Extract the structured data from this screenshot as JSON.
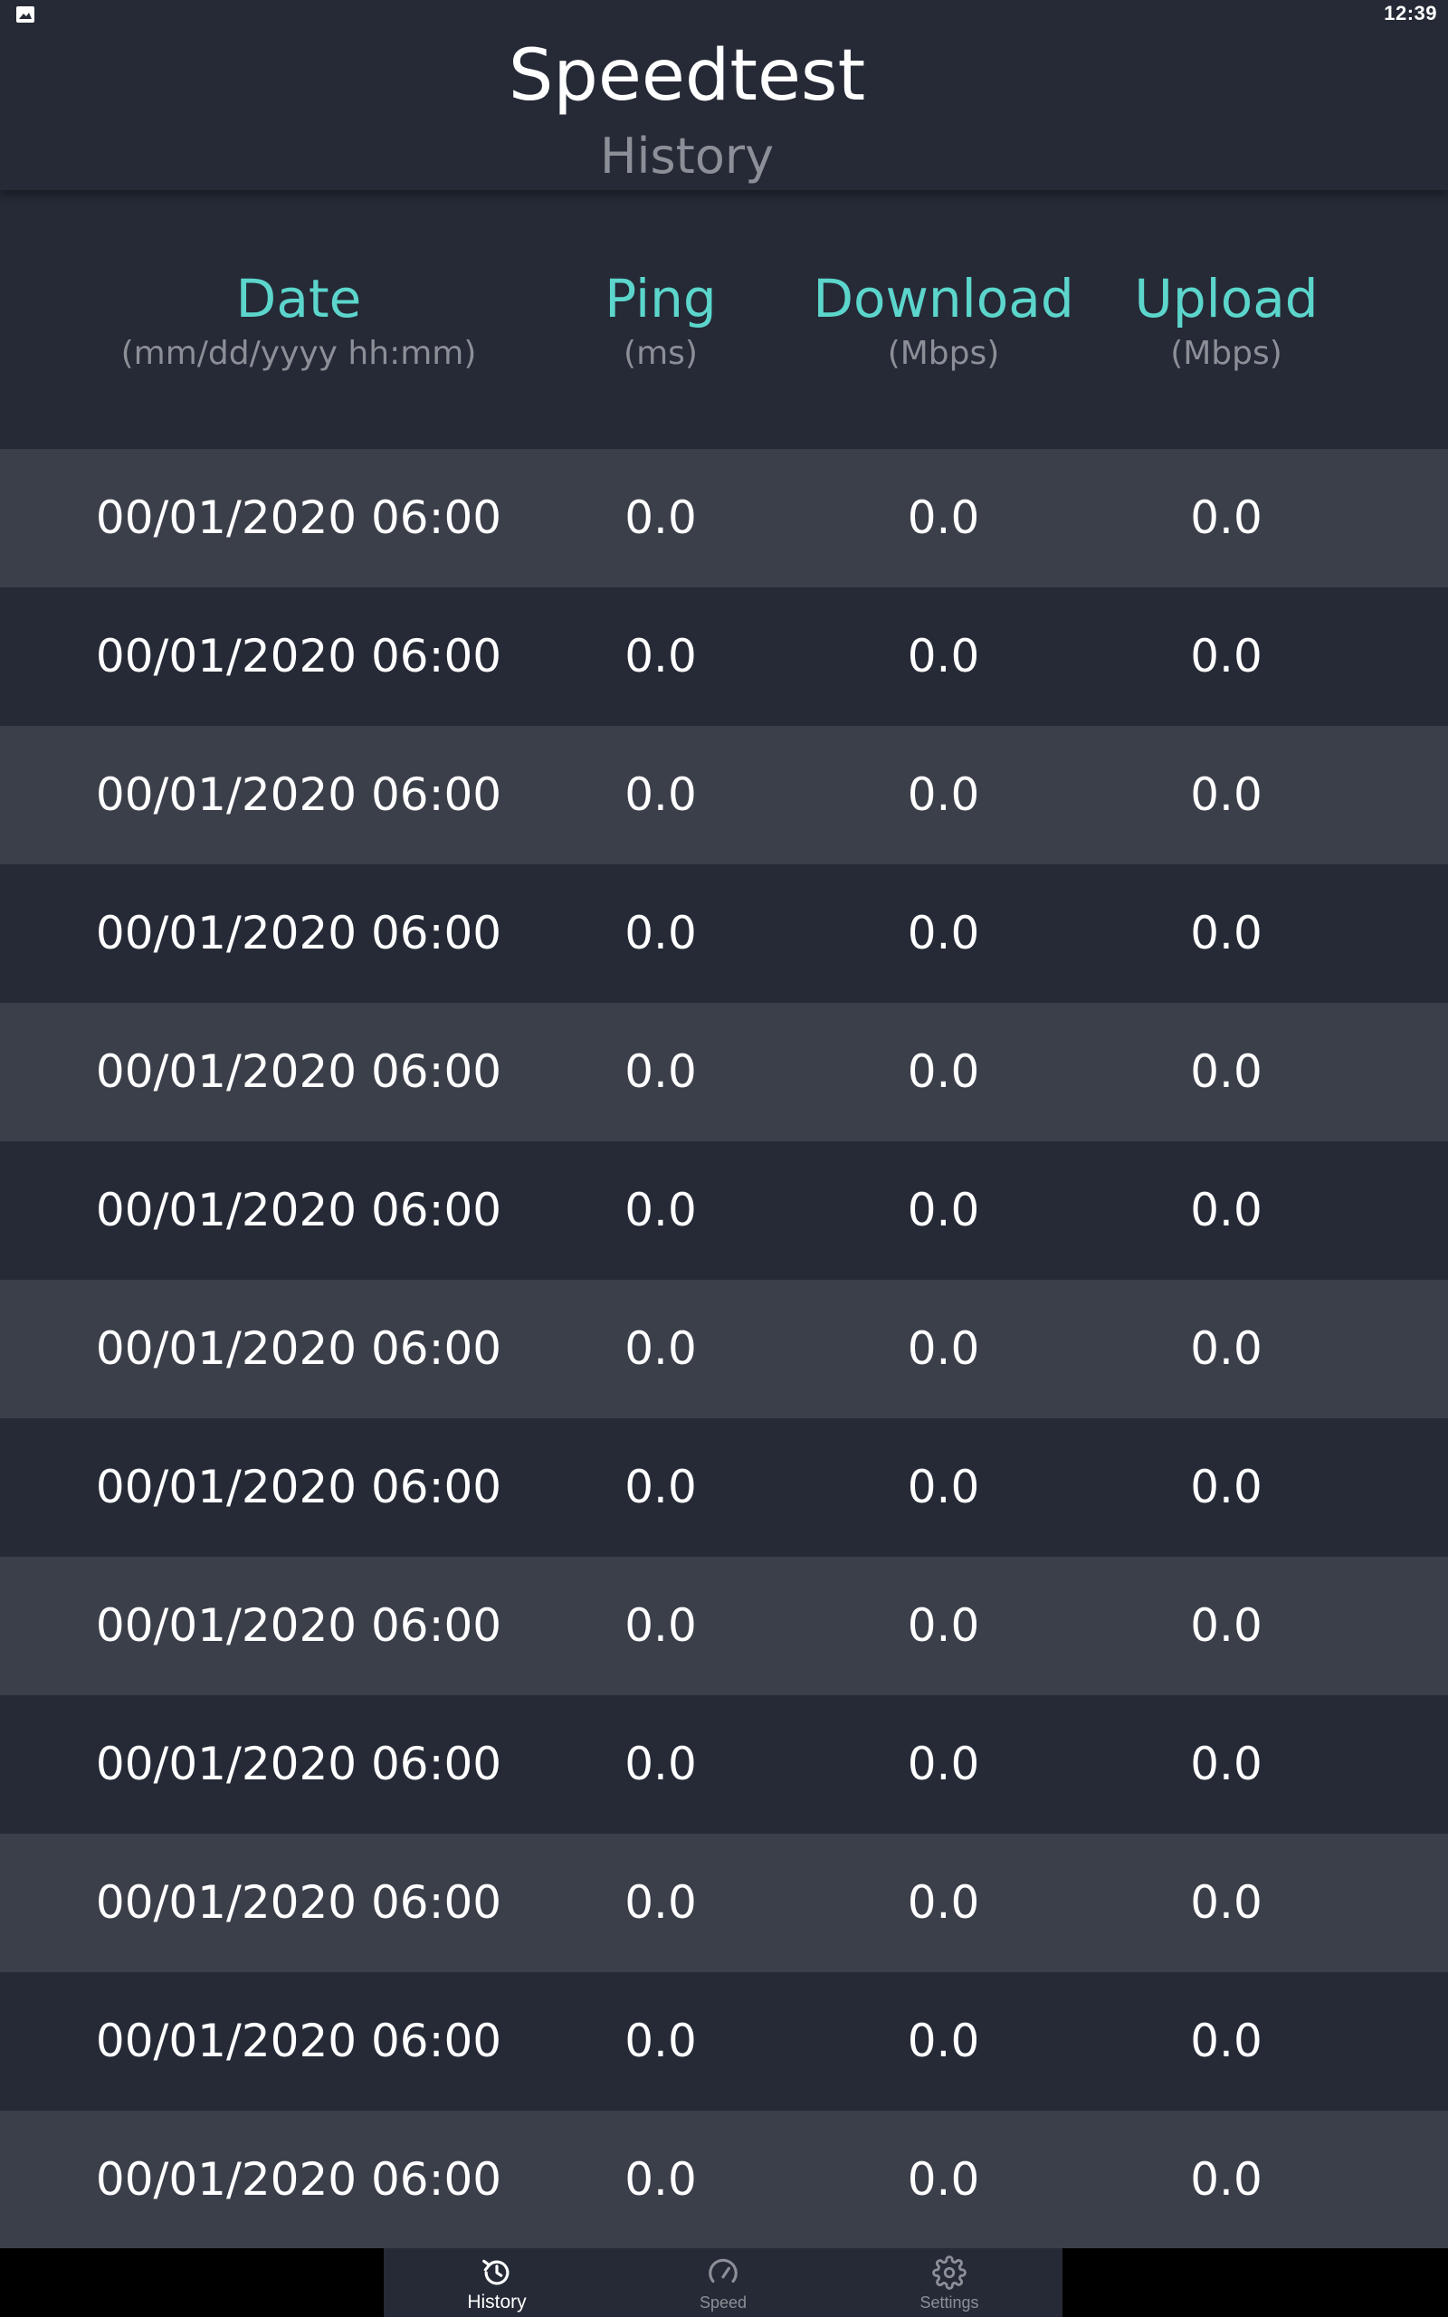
{
  "status_bar": {
    "time": "12:39",
    "notification_icon": "image-icon"
  },
  "header": {
    "title": "Speedtest",
    "subtitle": "History"
  },
  "columns": [
    {
      "name": "Date",
      "unit": "(mm/dd/yyyy hh:mm)"
    },
    {
      "name": "Ping",
      "unit": "(ms)"
    },
    {
      "name": "Download",
      "unit": "(Mbps)"
    },
    {
      "name": "Upload",
      "unit": "(Mbps)"
    }
  ],
  "rows": [
    {
      "date": "00/01/2020 06:00",
      "ping": "0.0",
      "download": "0.0",
      "upload": "0.0"
    },
    {
      "date": "00/01/2020 06:00",
      "ping": "0.0",
      "download": "0.0",
      "upload": "0.0"
    },
    {
      "date": "00/01/2020 06:00",
      "ping": "0.0",
      "download": "0.0",
      "upload": "0.0"
    },
    {
      "date": "00/01/2020 06:00",
      "ping": "0.0",
      "download": "0.0",
      "upload": "0.0"
    },
    {
      "date": "00/01/2020 06:00",
      "ping": "0.0",
      "download": "0.0",
      "upload": "0.0"
    },
    {
      "date": "00/01/2020 06:00",
      "ping": "0.0",
      "download": "0.0",
      "upload": "0.0"
    },
    {
      "date": "00/01/2020 06:00",
      "ping": "0.0",
      "download": "0.0",
      "upload": "0.0"
    },
    {
      "date": "00/01/2020 06:00",
      "ping": "0.0",
      "download": "0.0",
      "upload": "0.0"
    },
    {
      "date": "00/01/2020 06:00",
      "ping": "0.0",
      "download": "0.0",
      "upload": "0.0"
    },
    {
      "date": "00/01/2020 06:00",
      "ping": "0.0",
      "download": "0.0",
      "upload": "0.0"
    },
    {
      "date": "00/01/2020 06:00",
      "ping": "0.0",
      "download": "0.0",
      "upload": "0.0"
    },
    {
      "date": "00/01/2020 06:00",
      "ping": "0.0",
      "download": "0.0",
      "upload": "0.0"
    },
    {
      "date": "00/01/2020 06:00",
      "ping": "0.0",
      "download": "0.0",
      "upload": "0.0"
    }
  ],
  "nav": [
    {
      "label": "History",
      "icon": "history-icon",
      "active": true
    },
    {
      "label": "Speed",
      "icon": "speedometer-icon",
      "active": false
    },
    {
      "label": "Settings",
      "icon": "gear-icon",
      "active": false
    }
  ],
  "colors": {
    "background": "#252a36",
    "row_alt": "#3b3f4a",
    "accent": "#5cd6cc",
    "muted": "#8c8f97",
    "text": "#ffffff"
  }
}
